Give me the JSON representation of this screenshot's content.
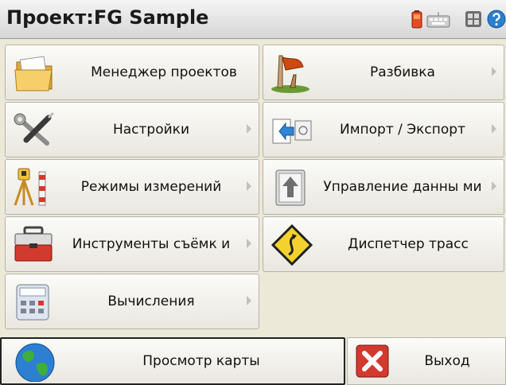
{
  "header": {
    "title": "Проект:FG Sample",
    "status_icons": [
      "battery-icon",
      "keyboard-icon",
      "settings-icon",
      "help-icon"
    ]
  },
  "menu": {
    "project_manager": "Менеджер проектов",
    "stakeout": "Разбивка",
    "settings": "Настройки",
    "import_export": "Импорт / Экспорт",
    "survey_modes": "Режимы измерений",
    "data_management": "Управление данны ми",
    "instruments": "Инструменты съёмк и",
    "road_manager": "Диспетчер трасс",
    "calculations": "Вычисления"
  },
  "footer": {
    "map_view": "Просмотр карты",
    "exit": "Выход"
  },
  "colors": {
    "accent_red": "#d23a2e",
    "tile_border": "#b5b3a8"
  }
}
